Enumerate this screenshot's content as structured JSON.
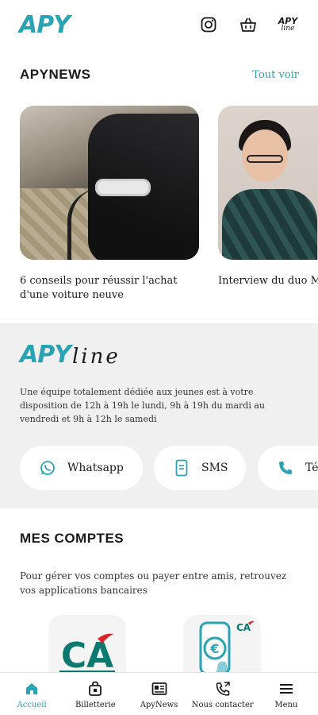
{
  "header": {
    "logo_text": "APY",
    "apyline_mini_a": "APY",
    "apyline_mini_b": "line",
    "icons": [
      "instagram-icon",
      "basket-icon",
      "apyline-logo"
    ]
  },
  "news": {
    "title": "APYNEWS",
    "see_all": "Tout voir",
    "items": [
      {
        "caption": "6 conseils pour réussir l'achat d'une voiture neuve",
        "image": "electric-car-charging"
      },
      {
        "caption": "Interview du duo M",
        "image": "woman-portrait"
      }
    ]
  },
  "apyline": {
    "logo_a": "APY",
    "logo_b": "line",
    "description": "Une équipe totalement dédiée aux jeunes est à votre disposition de 12h à 19h le lundi, 9h à 19h du mardi au vendredi et 9h à 12h le samedi",
    "contacts": [
      {
        "label": "Whatsapp",
        "icon": "whatsapp-icon"
      },
      {
        "label": "SMS",
        "icon": "sms-icon"
      },
      {
        "label": "Té",
        "icon": "phone-icon"
      }
    ]
  },
  "accounts": {
    "title": "MES COMPTES",
    "description": "Pour gérer vos comptes ou payer entre amis, retrouvez vos applications bancaires",
    "apps": [
      {
        "icon": "credit-agricole-app-icon",
        "logo_text": "CA"
      },
      {
        "icon": "paiement-mobile-app-icon",
        "logo_text": "€",
        "badge": "CA"
      }
    ]
  },
  "bottom_nav": {
    "items": [
      {
        "label": "Accueil",
        "icon": "home-icon",
        "active": true
      },
      {
        "label": "Billetterie",
        "icon": "ticket-bag-icon",
        "active": false
      },
      {
        "label": "ApyNews",
        "icon": "news-icon",
        "active": false
      },
      {
        "label": "Nous contacter",
        "icon": "contact-phone-icon",
        "active": false
      },
      {
        "label": "Menu",
        "icon": "menu-icon",
        "active": false
      }
    ]
  },
  "colors": {
    "accent": "#2aa3b3",
    "band": "#f0f0f0",
    "ca_green": "#0a7a6e",
    "ca_red": "#d9262c"
  }
}
